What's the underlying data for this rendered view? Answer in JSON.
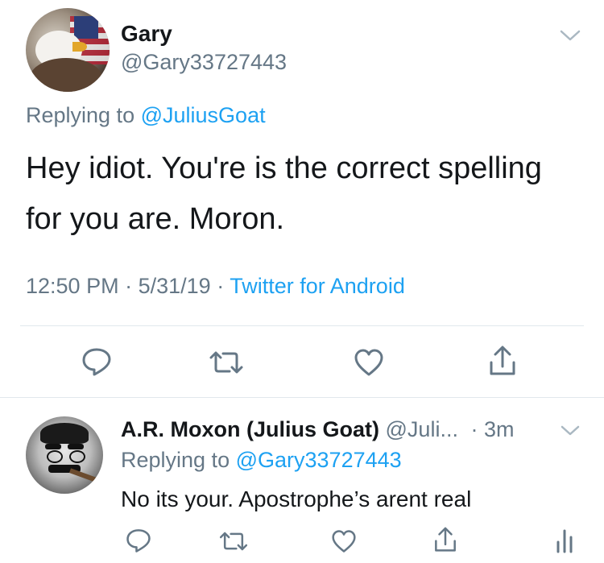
{
  "main_tweet": {
    "author_name": "Gary",
    "author_handle": "@Gary33727443",
    "replying_prefix": "Replying to",
    "replying_handle": "@JuliusGoat",
    "text_line1": "Hey idiot. You're is the correct spelling",
    "text_line2": "for you are. Moron.",
    "time": "12:50 PM",
    "date": "5/31/19",
    "source": "Twitter for Android",
    "sep": "·"
  },
  "reply_tweet": {
    "author_name": "A.R. Moxon (Julius Goat)",
    "author_handle": "@Juli...",
    "time_ago": "· 3m",
    "replying_prefix": "Replying to",
    "replying_handle": "@Gary33727443",
    "text": "No its your. Apostrophe’s arent real"
  },
  "icons": {
    "reply": "reply-icon",
    "retweet": "retweet-icon",
    "like": "heart-icon",
    "share": "share-icon",
    "analytics": "analytics-icon",
    "menu": "chevron-down-icon"
  },
  "colors": {
    "link": "#1da1f2",
    "secondary_text": "#657786",
    "icon": "#657786",
    "divider": "#e1e8ed"
  }
}
